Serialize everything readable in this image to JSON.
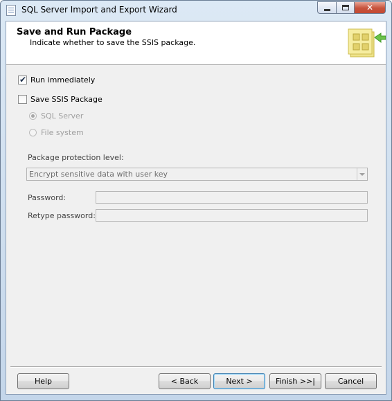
{
  "window": {
    "title": "SQL Server Import and Export Wizard",
    "icon": "wizard-document-icon"
  },
  "header": {
    "title": "Save and Run Package",
    "subtitle": "Indicate whether to save the SSIS package.",
    "graphic": "package-folder-arrow-icon"
  },
  "options": {
    "run_immediately": {
      "label": "Run immediately",
      "checked": true
    },
    "save_ssis_package": {
      "label": "Save SSIS Package",
      "checked": false
    },
    "sql_server": {
      "label": "SQL Server",
      "selected": true,
      "enabled": false
    },
    "file_system": {
      "label": "File system",
      "selected": false,
      "enabled": false
    }
  },
  "protection": {
    "label": "Package protection level:",
    "value": "Encrypt sensitive data with user key"
  },
  "password": {
    "label": "Password:",
    "value": ""
  },
  "retype_password": {
    "label": "Retype password:",
    "value": ""
  },
  "buttons": {
    "help": "Help",
    "back": "< Back",
    "next": "Next >",
    "finish": "Finish >>|",
    "cancel": "Cancel"
  },
  "colors": {
    "close_button": "#c7523c",
    "disabled_text": "#a0a0a0",
    "header_background": "#ffffff",
    "client_background": "#f0f0f0"
  }
}
